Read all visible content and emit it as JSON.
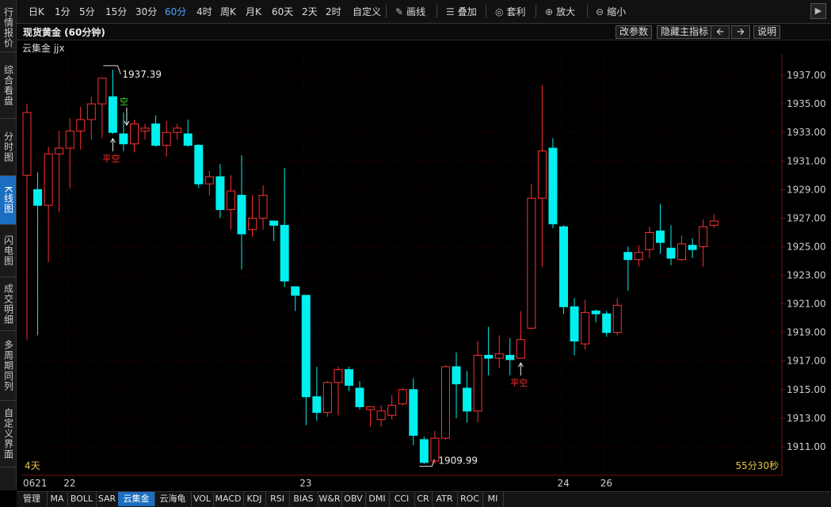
{
  "sidebar": {
    "items": [
      {
        "label": "行情报价",
        "active": false
      },
      {
        "label": "综合看盘",
        "active": false
      },
      {
        "label": "分时图",
        "active": false
      },
      {
        "label": "K线图",
        "active": true
      },
      {
        "label": "闪电图",
        "active": false
      },
      {
        "label": "成交明细",
        "active": false
      },
      {
        "label": "多周期同列",
        "active": false
      },
      {
        "label": "自定义界面",
        "active": false
      }
    ]
  },
  "toolbar": {
    "periods": [
      "日K",
      "1分",
      "5分",
      "15分",
      "30分",
      "60分",
      "4时",
      "周K",
      "月K",
      "60天",
      "2天",
      "2时",
      "自定义"
    ],
    "active_period": "60分",
    "tools": [
      {
        "label": "画线",
        "icon": "pencil-icon"
      },
      {
        "label": "叠加",
        "icon": "layers-icon"
      },
      {
        "label": "套利",
        "icon": "money-bag-icon"
      },
      {
        "label": "放大",
        "icon": "zoom-in-icon"
      },
      {
        "label": "缩小",
        "icon": "zoom-out-icon"
      }
    ],
    "next_icon": "chevron-right-icon"
  },
  "titlebar": {
    "title": "现货黄金 (60分钟)",
    "buttons": {
      "params": "改参数",
      "hide_main": "隐藏主指标",
      "prev_icon": "arrow-left-icon",
      "next_icon": "arrow-right-icon",
      "help": "说明"
    }
  },
  "indicator_label": "云集金 jjx",
  "chart_data": {
    "type": "candlestick",
    "ylim": [
      1909.0,
      1938.5
    ],
    "yticks": [
      "1937.00",
      "1935.00",
      "1933.00",
      "1931.00",
      "1929.00",
      "1927.00",
      "1925.00",
      "1923.00",
      "1921.00",
      "1919.00",
      "1917.00",
      "1915.00",
      "1913.00",
      "1911.00"
    ],
    "xlabels": [
      {
        "label": "0621",
        "index": 0
      },
      {
        "label": "22",
        "index": 4
      },
      {
        "label": "23",
        "index": 26
      },
      {
        "label": "24",
        "index": 50
      },
      {
        "label": "26",
        "index": 54
      }
    ],
    "candles": [
      {
        "o": 1930.0,
        "h": 1935.0,
        "l": 1918.5,
        "c": 1934.4
      },
      {
        "o": 1929.0,
        "h": 1930.2,
        "l": 1918.8,
        "c": 1927.9
      },
      {
        "o": 1927.9,
        "h": 1932.0,
        "l": 1923.9,
        "c": 1931.5
      },
      {
        "o": 1931.5,
        "h": 1933.1,
        "l": 1927.4,
        "c": 1931.9
      },
      {
        "o": 1931.9,
        "h": 1934.0,
        "l": 1929.1,
        "c": 1933.1
      },
      {
        "o": 1933.1,
        "h": 1934.8,
        "l": 1931.8,
        "c": 1933.9
      },
      {
        "o": 1933.9,
        "h": 1935.5,
        "l": 1932.5,
        "c": 1935.0
      },
      {
        "o": 1935.0,
        "h": 1936.5,
        "l": 1932.6,
        "c": 1936.8
      },
      {
        "o": 1935.5,
        "h": 1937.4,
        "l": 1932.9,
        "c": 1933.0
      },
      {
        "o": 1932.9,
        "h": 1934.4,
        "l": 1931.7,
        "c": 1932.2
      },
      {
        "o": 1932.2,
        "h": 1933.9,
        "l": 1931.6,
        "c": 1933.6
      },
      {
        "o": 1933.1,
        "h": 1933.6,
        "l": 1932.5,
        "c": 1933.3
      },
      {
        "o": 1933.6,
        "h": 1934.2,
        "l": 1932.0,
        "c": 1932.1
      },
      {
        "o": 1932.1,
        "h": 1933.8,
        "l": 1931.3,
        "c": 1933.0
      },
      {
        "o": 1933.0,
        "h": 1933.6,
        "l": 1932.5,
        "c": 1933.3
      },
      {
        "o": 1932.9,
        "h": 1933.9,
        "l": 1932.0,
        "c": 1932.1
      },
      {
        "o": 1932.1,
        "h": 1932.2,
        "l": 1929.1,
        "c": 1929.4
      },
      {
        "o": 1929.4,
        "h": 1930.3,
        "l": 1928.6,
        "c": 1929.9
      },
      {
        "o": 1929.9,
        "h": 1930.8,
        "l": 1927.0,
        "c": 1927.6
      },
      {
        "o": 1927.6,
        "h": 1930.0,
        "l": 1926.2,
        "c": 1928.9
      },
      {
        "o": 1928.6,
        "h": 1931.4,
        "l": 1923.4,
        "c": 1925.9
      },
      {
        "o": 1926.2,
        "h": 1928.6,
        "l": 1925.7,
        "c": 1927.0
      },
      {
        "o": 1927.0,
        "h": 1929.3,
        "l": 1926.2,
        "c": 1928.6
      },
      {
        "o": 1926.8,
        "h": 1926.8,
        "l": 1925.4,
        "c": 1926.5
      },
      {
        "o": 1926.5,
        "h": 1930.5,
        "l": 1922.2,
        "c": 1922.6
      },
      {
        "o": 1922.2,
        "h": 1922.2,
        "l": 1920.5,
        "c": 1921.6
      },
      {
        "o": 1921.6,
        "h": 1921.6,
        "l": 1912.5,
        "c": 1914.5
      },
      {
        "o": 1914.5,
        "h": 1916.6,
        "l": 1912.8,
        "c": 1913.4
      },
      {
        "o": 1913.4,
        "h": 1915.6,
        "l": 1913.1,
        "c": 1915.5
      },
      {
        "o": 1915.5,
        "h": 1916.6,
        "l": 1913.2,
        "c": 1916.4
      },
      {
        "o": 1916.4,
        "h": 1916.6,
        "l": 1914.9,
        "c": 1915.3
      },
      {
        "o": 1915.1,
        "h": 1915.6,
        "l": 1913.6,
        "c": 1913.8
      },
      {
        "o": 1913.6,
        "h": 1913.8,
        "l": 1912.4,
        "c": 1913.8
      },
      {
        "o": 1912.9,
        "h": 1913.9,
        "l": 1912.4,
        "c": 1913.5
      },
      {
        "o": 1913.2,
        "h": 1914.6,
        "l": 1912.9,
        "c": 1913.9
      },
      {
        "o": 1914.0,
        "h": 1915.1,
        "l": 1913.9,
        "c": 1915.0
      },
      {
        "o": 1915.0,
        "h": 1915.8,
        "l": 1911.1,
        "c": 1911.8
      },
      {
        "o": 1911.5,
        "h": 1911.7,
        "l": 1909.8,
        "c": 1909.9
      },
      {
        "o": 1910.0,
        "h": 1912.1,
        "l": 1909.8,
        "c": 1911.6
      },
      {
        "o": 1911.6,
        "h": 1916.7,
        "l": 1911.5,
        "c": 1916.6
      },
      {
        "o": 1916.6,
        "h": 1917.6,
        "l": 1913.0,
        "c": 1915.4
      },
      {
        "o": 1915.1,
        "h": 1916.3,
        "l": 1912.7,
        "c": 1913.5
      },
      {
        "o": 1913.5,
        "h": 1918.4,
        "l": 1912.7,
        "c": 1917.4
      },
      {
        "o": 1917.4,
        "h": 1919.4,
        "l": 1916.0,
        "c": 1917.2
      },
      {
        "o": 1917.2,
        "h": 1918.8,
        "l": 1916.5,
        "c": 1917.5
      },
      {
        "o": 1917.4,
        "h": 1918.6,
        "l": 1916.0,
        "c": 1917.1
      },
      {
        "o": 1917.2,
        "h": 1920.5,
        "l": 1917.2,
        "c": 1918.5
      },
      {
        "o": 1919.3,
        "h": 1929.4,
        "l": 1919.2,
        "c": 1928.4
      },
      {
        "o": 1928.4,
        "h": 1936.3,
        "l": 1923.6,
        "c": 1931.7
      },
      {
        "o": 1931.9,
        "h": 1932.6,
        "l": 1926.3,
        "c": 1926.6
      },
      {
        "o": 1926.4,
        "h": 1926.5,
        "l": 1920.3,
        "c": 1920.8
      },
      {
        "o": 1920.8,
        "h": 1921.4,
        "l": 1917.4,
        "c": 1918.4
      },
      {
        "o": 1918.2,
        "h": 1921.3,
        "l": 1917.8,
        "c": 1920.4
      },
      {
        "o": 1920.5,
        "h": 1920.6,
        "l": 1919.7,
        "c": 1920.3
      },
      {
        "o": 1920.3,
        "h": 1920.5,
        "l": 1918.7,
        "c": 1919.0
      },
      {
        "o": 1919.0,
        "h": 1921.4,
        "l": 1918.8,
        "c": 1920.9
      },
      {
        "o": 1924.6,
        "h": 1925.0,
        "l": 1921.9,
        "c": 1924.1
      },
      {
        "o": 1924.1,
        "h": 1925.1,
        "l": 1923.6,
        "c": 1924.6
      },
      {
        "o": 1924.8,
        "h": 1926.4,
        "l": 1924.2,
        "c": 1926.0
      },
      {
        "o": 1926.1,
        "h": 1928.0,
        "l": 1924.5,
        "c": 1925.3
      },
      {
        "o": 1924.9,
        "h": 1926.5,
        "l": 1923.7,
        "c": 1924.2
      },
      {
        "o": 1924.1,
        "h": 1925.8,
        "l": 1924.0,
        "c": 1925.2
      },
      {
        "o": 1925.1,
        "h": 1925.6,
        "l": 1924.2,
        "c": 1924.8
      },
      {
        "o": 1925.0,
        "h": 1926.9,
        "l": 1923.6,
        "c": 1926.4
      },
      {
        "o": 1926.5,
        "h": 1927.3,
        "l": 1926.3,
        "c": 1926.8
      }
    ],
    "annotations": {
      "high_label": "1937.39",
      "low_label": "1909.99",
      "signal_short": "空",
      "signal_close_short": "平空",
      "signal_close_short_2": "平空"
    },
    "bottom_left_label": "4天",
    "bottom_right_label": "55分30秒",
    "colors": {
      "up": "#ff3030",
      "down": "#00f0f0",
      "grid": "#3a0000",
      "axis": "#7a1010"
    }
  },
  "bottom_tabs": [
    "管理",
    "MA",
    "BOLL",
    "SAR",
    "云集金",
    "云海龟",
    "VOL",
    "MACD",
    "KDJ",
    "RSI",
    "BIAS",
    "W&R",
    "OBV",
    "DMI",
    "CCI",
    "CR",
    "ATR",
    "ROC",
    "MI"
  ],
  "bottom_active": "云集金"
}
